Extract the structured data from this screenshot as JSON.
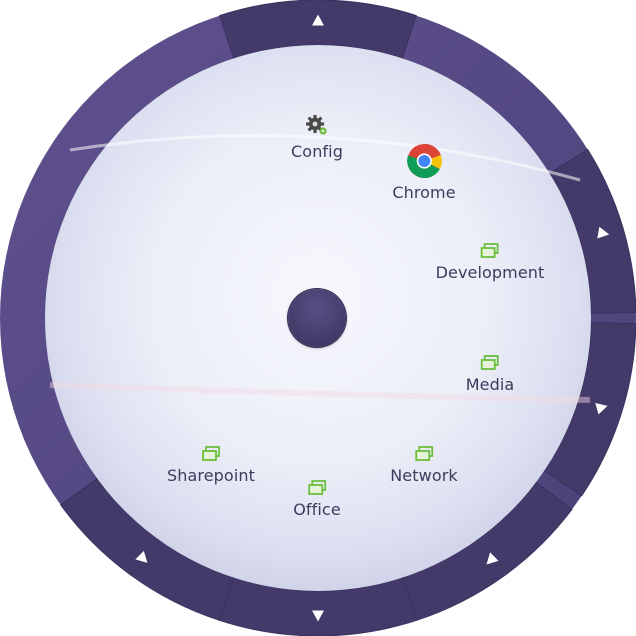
{
  "menu": {
    "items": [
      {
        "label": "Config",
        "icon": "gear-icon"
      },
      {
        "label": "Chrome",
        "icon": "chrome-icon"
      },
      {
        "label": "Development",
        "icon": "window-group-icon"
      },
      {
        "label": "Media",
        "icon": "window-group-icon"
      },
      {
        "label": "Network",
        "icon": "window-group-icon"
      },
      {
        "label": "Office",
        "icon": "window-group-icon"
      },
      {
        "label": "Sharepoint",
        "icon": "window-group-icon"
      }
    ],
    "center": {
      "icon": "center-circle-button"
    },
    "ring_arrows": [
      "up",
      "right",
      "right",
      "down-left",
      "down",
      "down-left"
    ]
  },
  "colors": {
    "ring_dark": "#433a69",
    "ring_light": "#5d4f8c",
    "inner_bg": "#eef0f8",
    "label": "#3a3d5c",
    "group_icon": "#6bbf3a",
    "chrome_red": "#db4437",
    "chrome_yellow": "#f4c20d",
    "chrome_green": "#0f9d58",
    "chrome_blue": "#4285f4"
  }
}
